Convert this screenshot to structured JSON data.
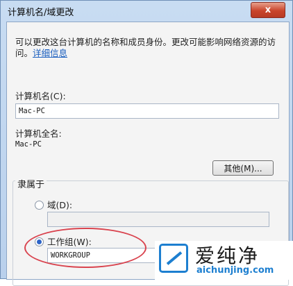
{
  "window": {
    "title": "计算机名/域更改",
    "close_label": "x"
  },
  "intro": {
    "text": "可以更改这台计算机的名称和成员身份。更改可能影响网络资源的访问。",
    "link": "详细信息"
  },
  "computer_name": {
    "label": "计算机名(C):",
    "value": "Mac-PC"
  },
  "full_name": {
    "label": "计算机全名:",
    "value": "Mac-PC"
  },
  "other_button": "其他(M)...",
  "membership": {
    "legend": "隶属于",
    "domain_label": "域(D):",
    "domain_value": "",
    "workgroup_label": "工作组(W):",
    "workgroup_value": "WORKGROUP",
    "selected": "workgroup"
  },
  "watermark": {
    "brand": "爱纯净",
    "url": "aichunjing.com"
  }
}
